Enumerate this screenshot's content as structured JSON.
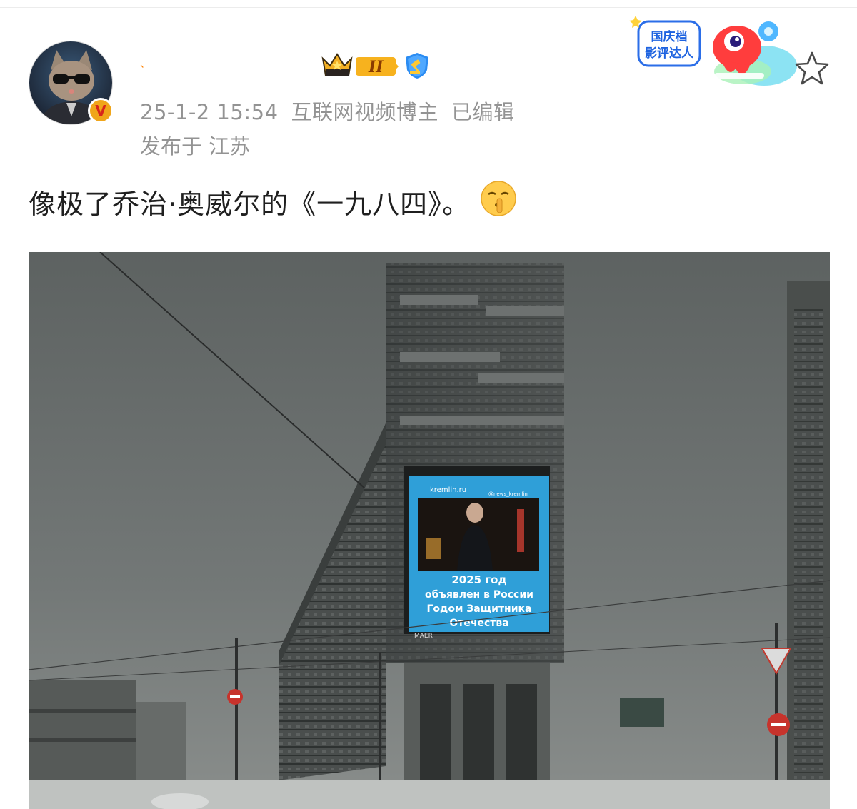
{
  "post": {
    "username": "、",
    "timestamp": "25-1-2 15:54",
    "author_label": "互联网视频博主",
    "edited": "已编辑",
    "location": "发布于 江苏",
    "content": "像极了乔治·奥威尔的《一九八四》。",
    "verified_badge": "V",
    "level_badge": "II"
  },
  "sticker": {
    "line1": "国庆档",
    "line2": "影评达人"
  },
  "image": {
    "screen_site": "kremlin.ru",
    "screen_handle": "@news_kremlin",
    "screen_line1": "2025 год",
    "screen_line2": "объявлен в России",
    "screen_line3": "Годом Защитника",
    "screen_line4": "Отечества",
    "screen_brand": "MAER"
  },
  "icons": [
    "avatar-cat",
    "crown-level-icon",
    "gavel-shield-icon",
    "favorite-star-icon",
    "shush-emoji-icon"
  ],
  "colors": {
    "meta_text": "#939393",
    "body_text": "#1f1f1f",
    "username_orange": "#ff8200",
    "screen_blue": "#2f9fd8",
    "sky_gray": "#6b7070"
  }
}
